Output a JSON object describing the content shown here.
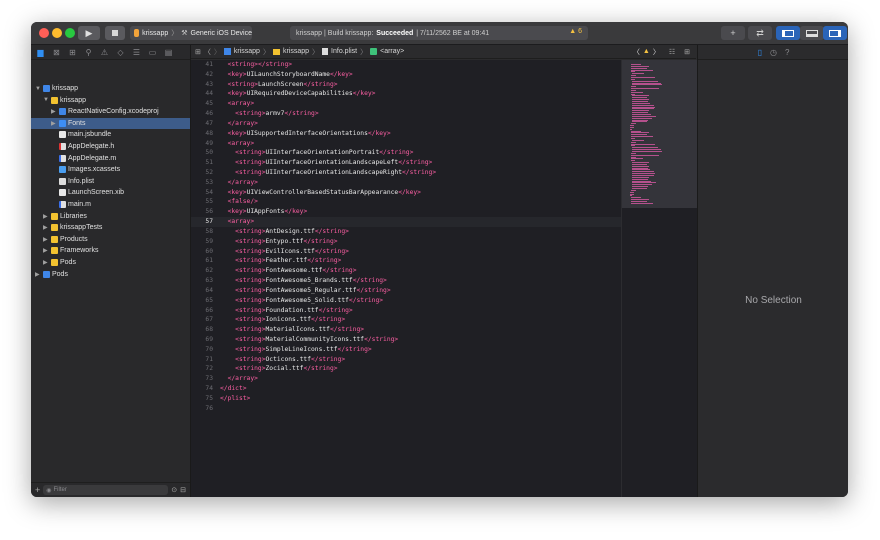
{
  "titlebar": {
    "scheme_project": "krissapp",
    "scheme_device": "Generic iOS Device",
    "activity_prefix": "krissapp | Build krissapp: ",
    "activity_status": "Succeeded",
    "activity_date": " | 7/11/2562 BE at 09:41",
    "warning_count": "6"
  },
  "navigator": {
    "filter_placeholder": "Filter",
    "items": [
      {
        "label": "krissapp",
        "icon": "proj",
        "depth": 0,
        "disc": "▼"
      },
      {
        "label": "krissapp",
        "icon": "folder",
        "depth": 1,
        "disc": "▼"
      },
      {
        "label": "ReactNativeConfig.xcodeproj",
        "icon": "proj",
        "depth": 2,
        "disc": "▶"
      },
      {
        "label": "Fonts",
        "icon": "bfolder",
        "depth": 2,
        "disc": "▶",
        "selected": true
      },
      {
        "label": "main.jsbundle",
        "icon": "file",
        "depth": 2,
        "disc": ""
      },
      {
        "label": "AppDelegate.h",
        "icon": "hfile",
        "depth": 2,
        "disc": ""
      },
      {
        "label": "AppDelegate.m",
        "icon": "mfile",
        "depth": 2,
        "disc": ""
      },
      {
        "label": "Images.xcassets",
        "icon": "assets",
        "depth": 2,
        "disc": ""
      },
      {
        "label": "Info.plist",
        "icon": "plist",
        "depth": 2,
        "disc": ""
      },
      {
        "label": "LaunchScreen.xib",
        "icon": "file",
        "depth": 2,
        "disc": ""
      },
      {
        "label": "main.m",
        "icon": "mfile",
        "depth": 2,
        "disc": ""
      },
      {
        "label": "Libraries",
        "icon": "folder",
        "depth": 1,
        "disc": "▶"
      },
      {
        "label": "krissappTests",
        "icon": "folder",
        "depth": 1,
        "disc": "▶"
      },
      {
        "label": "Products",
        "icon": "folder",
        "depth": 1,
        "disc": "▶"
      },
      {
        "label": "Frameworks",
        "icon": "folder",
        "depth": 1,
        "disc": "▶"
      },
      {
        "label": "Pods",
        "icon": "folder",
        "depth": 1,
        "disc": "▶"
      },
      {
        "label": "Pods",
        "icon": "proj",
        "depth": 0,
        "disc": "▶"
      }
    ]
  },
  "jumpbar": {
    "crumbs": [
      "krissapp",
      "krissapp",
      "Info.plist",
      "<array>"
    ]
  },
  "editor": {
    "current_line": 57,
    "lines": [
      {
        "n": 41,
        "code": "  <string></string>"
      },
      {
        "n": 42,
        "code": "  <key>UILaunchStoryboardName</key>"
      },
      {
        "n": 43,
        "code": "  <string>LaunchScreen</string>"
      },
      {
        "n": 44,
        "code": "  <key>UIRequiredDeviceCapabilities</key>"
      },
      {
        "n": 45,
        "code": "  <array>"
      },
      {
        "n": 46,
        "code": "    <string>armv7</string>"
      },
      {
        "n": 47,
        "code": "  </array>"
      },
      {
        "n": 48,
        "code": "  <key>UISupportedInterfaceOrientations</key>"
      },
      {
        "n": 49,
        "code": "  <array>"
      },
      {
        "n": 50,
        "code": "    <string>UIInterfaceOrientationPortrait</string>"
      },
      {
        "n": 51,
        "code": "    <string>UIInterfaceOrientationLandscapeLeft</string>"
      },
      {
        "n": 52,
        "code": "    <string>UIInterfaceOrientationLandscapeRight</string>"
      },
      {
        "n": 53,
        "code": "  </array>"
      },
      {
        "n": 54,
        "code": "  <key>UIViewControllerBasedStatusBarAppearance</key>"
      },
      {
        "n": 55,
        "code": "  <false/>"
      },
      {
        "n": 56,
        "code": "  <key>UIAppFonts</key>"
      },
      {
        "n": 57,
        "code": "  <array>"
      },
      {
        "n": 58,
        "code": "    <string>AntDesign.ttf</string>"
      },
      {
        "n": 59,
        "code": "    <string>Entypo.ttf</string>"
      },
      {
        "n": 60,
        "code": "    <string>EvilIcons.ttf</string>"
      },
      {
        "n": 61,
        "code": "    <string>Feather.ttf</string>"
      },
      {
        "n": 62,
        "code": "    <string>FontAwesome.ttf</string>"
      },
      {
        "n": 63,
        "code": "    <string>FontAwesome5_Brands.ttf</string>"
      },
      {
        "n": 64,
        "code": "    <string>FontAwesome5_Regular.ttf</string>"
      },
      {
        "n": 65,
        "code": "    <string>FontAwesome5_Solid.ttf</string>"
      },
      {
        "n": 66,
        "code": "    <string>Foundation.ttf</string>"
      },
      {
        "n": 67,
        "code": "    <string>Ionicons.ttf</string>"
      },
      {
        "n": 68,
        "code": "    <string>MaterialIcons.ttf</string>"
      },
      {
        "n": 69,
        "code": "    <string>MaterialCommunityIcons.ttf</string>"
      },
      {
        "n": 70,
        "code": "    <string>SimpleLineIcons.ttf</string>"
      },
      {
        "n": 71,
        "code": "    <string>Octicons.ttf</string>"
      },
      {
        "n": 72,
        "code": "    <string>Zocial.ttf</string>"
      },
      {
        "n": 73,
        "code": "  </array>"
      },
      {
        "n": 74,
        "code": "</dict>"
      },
      {
        "n": 75,
        "code": "</plist>"
      },
      {
        "n": 76,
        "code": ""
      }
    ]
  },
  "inspector": {
    "empty_label": "No Selection"
  },
  "colors": {
    "tag": "#fc5fa3",
    "text": "#e8e8e8",
    "accent": "#2f8ef2"
  }
}
